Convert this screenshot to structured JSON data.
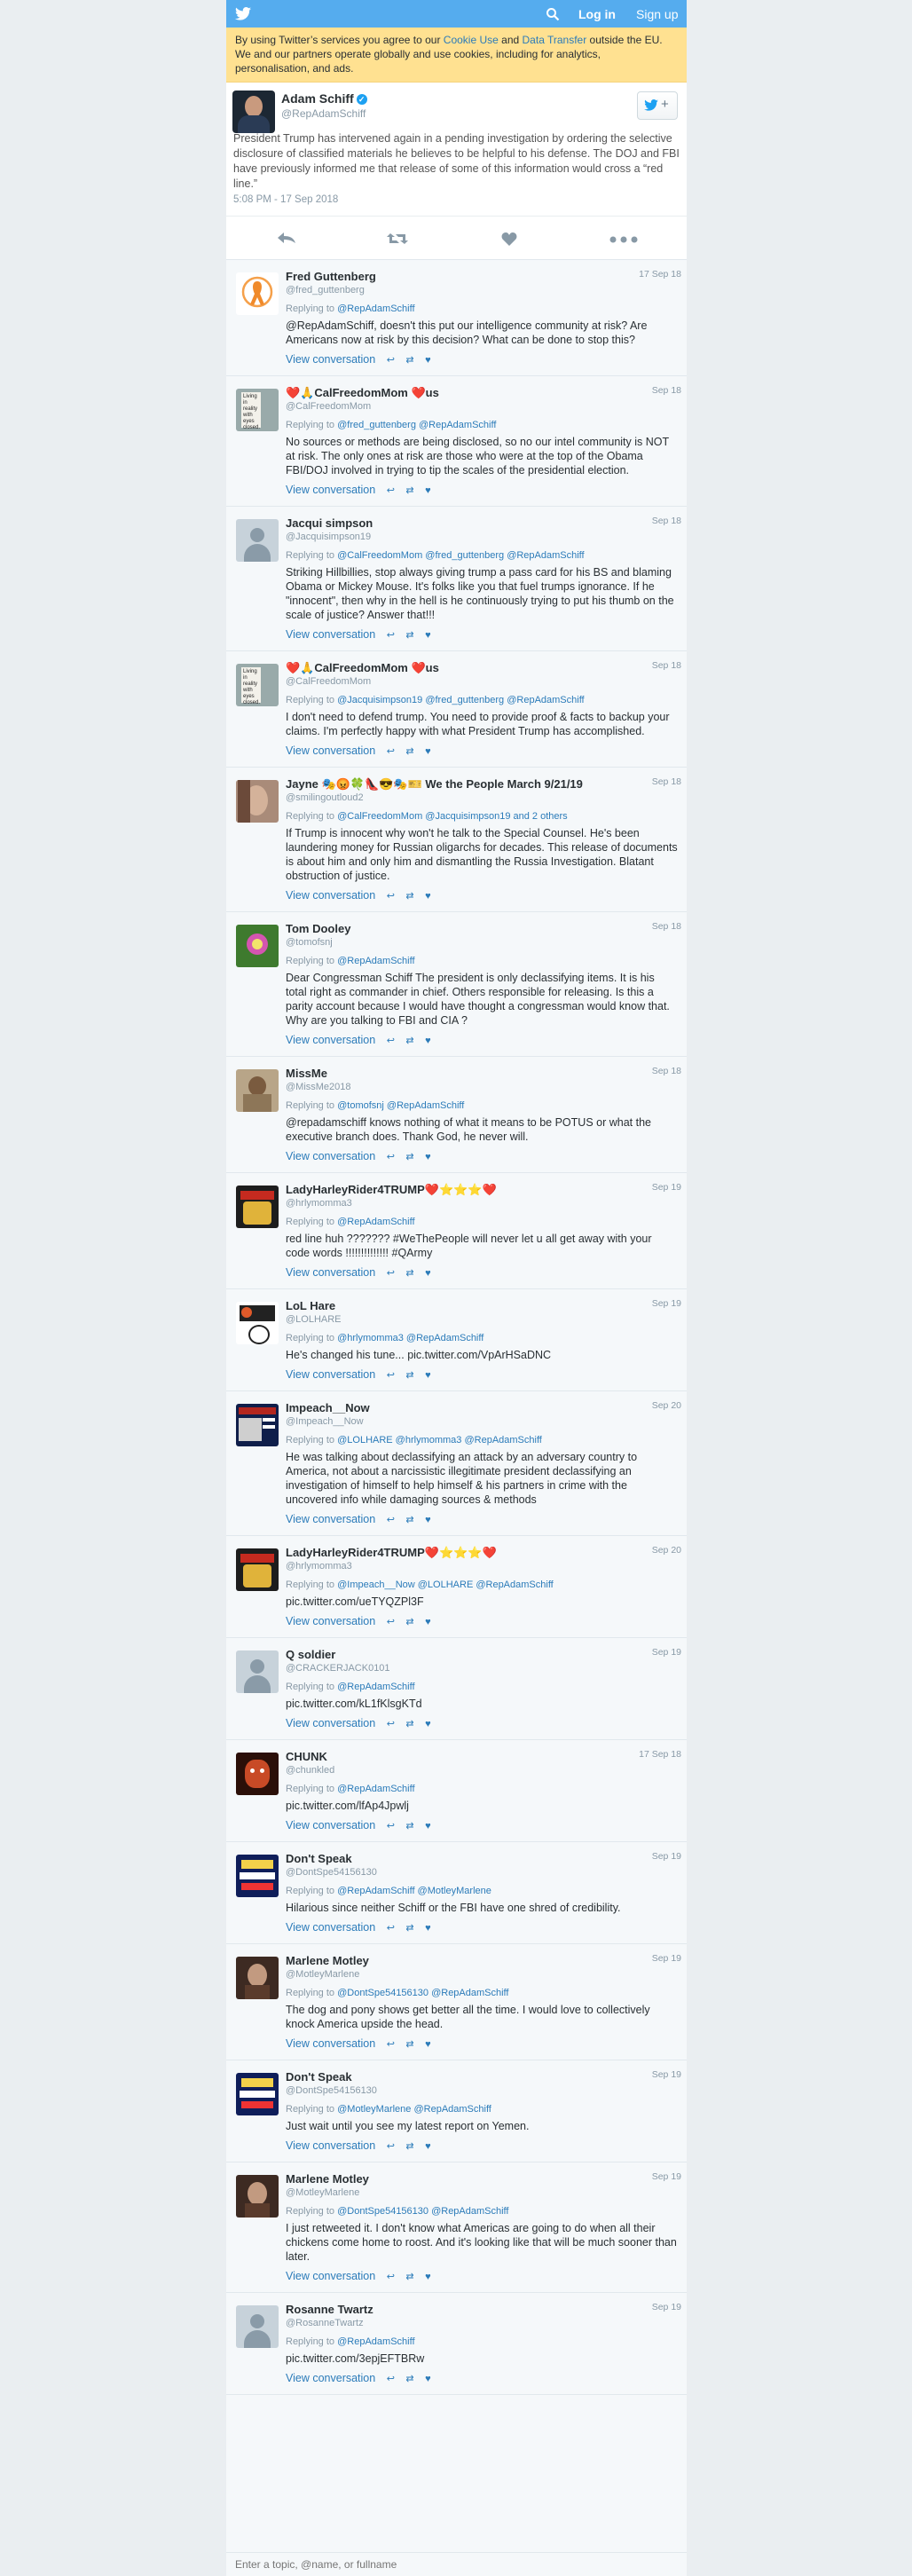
{
  "topbar": {
    "login": "Log in",
    "signup": "Sign up"
  },
  "cookie": {
    "p1": "By using Twitter’s services you agree to our ",
    "link1": "Cookie Use",
    "p2": " and ",
    "link2": "Data Transfer",
    "p3": " outside the EU. We and our partners operate globally and use cookies, including for analytics, personalisation, and ads."
  },
  "main": {
    "name": "Adam Schiff",
    "handle": "@RepAdamSchiff",
    "follow": "+",
    "text": "President Trump has intervened again in a pending investigation by ordering the selective disclosure of classified materials he believes to be helpful to his defense. The DOJ and FBI have previously informed me that release of some of this information would cross a “red line.”",
    "time": "5:08 PM - 17 Sep 2018"
  },
  "labels": {
    "replying": "Replying to",
    "view": "View conversation",
    "reply_icon": "↩",
    "retweet_icon": "⇄",
    "like_icon": "♥"
  },
  "tweets": [
    {
      "name": "Fred Guttenberg",
      "handle": "@fred_guttenberg",
      "date": "17 Sep 18",
      "reply": "@RepAdamSchiff",
      "text": "@RepAdamSchiff, doesn't this put our intelligence community at risk? Are Americans now at risk by this decision? What can be done to stop this?",
      "avatar": "ribbon"
    },
    {
      "name": "❤️🙏CalFreedomMom ❤️us",
      "handle": "@CalFreedomMom",
      "date": "Sep 18",
      "reply": "@fred_guttenberg @RepAdamSchiff",
      "text": "No sources or methods are being disclosed, so no our intel community is NOT at risk. The only ones at risk are those who were at the top of the Obama FBI/DOJ involved in trying to tip the scales of the presidential election.",
      "avatar": "sign"
    },
    {
      "name": "Jacqui simpson",
      "handle": "@Jacquisimpson19",
      "date": "Sep 18",
      "reply": "@CalFreedomMom @fred_guttenberg @RepAdamSchiff",
      "text": "Striking Hillbillies, stop always giving trump a pass card for his BS and blaming Obama or Mickey Mouse. It's folks like you that fuel trumps ignorance. If he \"innocent\", then why in the hell is he continuously trying to put his thumb on the scale of justice? Answer that!!!",
      "avatar": "default"
    },
    {
      "name": "❤️🙏CalFreedomMom ❤️us",
      "handle": "@CalFreedomMom",
      "date": "Sep 18",
      "reply": "@Jacquisimpson19 @fred_guttenberg @RepAdamSchiff",
      "text": "I don't need to defend trump. You need to provide proof & facts to backup your claims. I'm perfectly happy with what President Trump has accomplished.",
      "avatar": "sign"
    },
    {
      "name": "Jayne 🎭😡🍀👠😎🎭🎫 We the People March 9/21/19",
      "handle": "@smilingoutloud2",
      "date": "Sep 18",
      "reply": "@CalFreedomMom @Jacquisimpson19 and 2 others",
      "text": "If Trump is innocent why won't he talk to the Special Counsel. He's been laundering money for Russian oligarchs for decades. This release of documents is about him and only him and dismantling the Russia Investigation. Blatant obstruction of justice.",
      "avatar": "photo1"
    },
    {
      "name": "Tom Dooley",
      "handle": "@tomofsnj",
      "date": "Sep 18",
      "reply": "@RepAdamSchiff",
      "text": "Dear Congressman Schiff The president is only declassifying items. It is his total right as commander in chief. Others responsible for releasing. Is this a parity account because I would have thought a congressman would know that. Why are you talking to FBI and CIA ?",
      "avatar": "flower"
    },
    {
      "name": "MissMe",
      "handle": "@MissMe2018",
      "date": "Sep 18",
      "reply": "@tomofsnj @RepAdamSchiff",
      "text": "@repadamschiff knows nothing of what it means to be POTUS or what the executive branch does. Thank God, he never will.",
      "avatar": "photo2"
    },
    {
      "name": "LadyHarleyRider4TRUMP❤️⭐⭐⭐❤️",
      "handle": "@hrlymomma3",
      "date": "Sep 19",
      "reply": "@RepAdamSchiff",
      "text": "red line huh ??????? #WeThePeople will never let u all get away with your code words !!!!!!!!!!!!!! #QArmy",
      "avatar": "harley"
    },
    {
      "name": "LoL Hare",
      "handle": "@LOLHARE",
      "date": "Sep 19",
      "reply": "@hrlymomma3 @RepAdamSchiff",
      "text": "He's changed his tune... pic.twitter.com/VpArHSaDNC",
      "avatar": "hare"
    },
    {
      "name": "Impeach__Now",
      "handle": "@Impeach__Now",
      "date": "Sep 20",
      "reply": "@LOLHARE @hrlymomma3 @RepAdamSchiff",
      "text": "He was talking about declassifying an attack by an adversary country to America, not about a narcissistic illegitimate president declassifying an investigation of himself to help himself & his partners in crime with the uncovered info while damaging sources & methods",
      "avatar": "news"
    },
    {
      "name": "LadyHarleyRider4TRUMP❤️⭐⭐⭐❤️",
      "handle": "@hrlymomma3",
      "date": "Sep 20",
      "reply": "@Impeach__Now @LOLHARE @RepAdamSchiff",
      "text": "pic.twitter.com/ueTYQZPl3F",
      "avatar": "harley"
    },
    {
      "name": "Q soldier",
      "handle": "@CRACKERJACK0101",
      "date": "Sep 19",
      "reply": "@RepAdamSchiff",
      "text": "pic.twitter.com/kL1fKlsgKTd",
      "avatar": "default"
    },
    {
      "name": "CHUNK",
      "handle": "@chunkled",
      "date": "17 Sep 18",
      "reply": "@RepAdamSchiff",
      "text": "pic.twitter.com/lfAp4Jpwlj",
      "avatar": "chunk"
    },
    {
      "name": "Don't Speak",
      "handle": "@DontSpe54156130",
      "date": "Sep 19",
      "reply": "@RepAdamSchiff @MotleyMarlene",
      "text": "Hilarious since neither Schiff or the FBI have one shred of credibility.",
      "avatar": "fake"
    },
    {
      "name": "Marlene Motley",
      "handle": "@MotleyMarlene",
      "date": "Sep 19",
      "reply": "@DontSpe54156130 @RepAdamSchiff",
      "text": "The dog and pony shows get better all the time. I would love to collectively knock America upside the head.",
      "avatar": "photo3"
    },
    {
      "name": "Don't Speak",
      "handle": "@DontSpe54156130",
      "date": "Sep 19",
      "reply": "@MotleyMarlene @RepAdamSchiff",
      "text": "Just wait until you see my latest report on Yemen.",
      "avatar": "fake"
    },
    {
      "name": "Marlene Motley",
      "handle": "@MotleyMarlene",
      "date": "Sep 19",
      "reply": "@DontSpe54156130 @RepAdamSchiff",
      "text": "I just retweeted it. I don't know what Americas are going to do when all their chickens come home to roost. And it's looking like that will be much sooner than later.",
      "avatar": "photo3"
    },
    {
      "name": "Rosanne Twartz",
      "handle": "@RosanneTwartz",
      "date": "Sep 19",
      "reply": "@RepAdamSchiff",
      "text": "pic.twitter.com/3epjEFTBRw",
      "avatar": "default"
    }
  ],
  "search": {
    "placeholder": "Enter a topic, @name, or fullname"
  }
}
